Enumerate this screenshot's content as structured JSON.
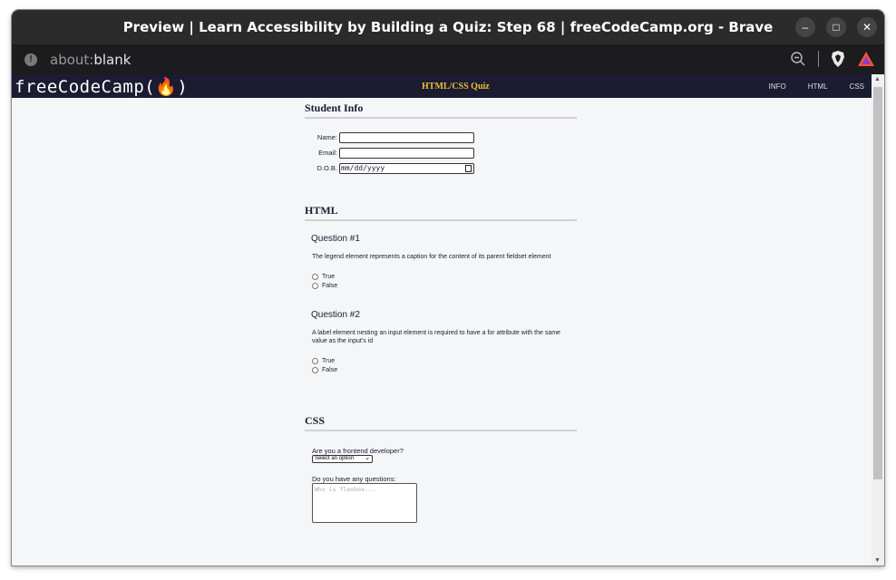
{
  "window": {
    "title": "Preview | Learn Accessibility by Building a Quiz: Step 68 | freeCodeCamp.org - Brave",
    "minimize_glyph": "–",
    "maximize_glyph": "□",
    "close_glyph": "✕"
  },
  "address_bar": {
    "scheme": "about:",
    "host": "blank"
  },
  "site": {
    "logo": "freeCodeCamp(🔥)",
    "quiz_title": "HTML/CSS Quiz",
    "nav": [
      "INFO",
      "HTML",
      "CSS"
    ]
  },
  "student_info": {
    "heading": "Student Info",
    "name_label": "Name:",
    "email_label": "Email:",
    "dob_label": "D.O.B.",
    "dob_placeholder": "mm/dd/yyyy"
  },
  "html_section": {
    "heading": "HTML",
    "questions": [
      {
        "title": "Question #1",
        "text": "The legend element represents a caption for the content of its parent fieldset element",
        "options": [
          "True",
          "False"
        ]
      },
      {
        "title": "Question #2",
        "text": "A label element nesting an input element is required to have a for attribute with the same value as the input's id",
        "options": [
          "True",
          "False"
        ]
      }
    ]
  },
  "css_section": {
    "heading": "CSS",
    "frontend_question": "Are you a frontend developer?",
    "select_value": "Select an option",
    "questions_label": "Do you have any questions:",
    "textarea_placeholder": "Who is flexbox..."
  },
  "colors": {
    "nav_bg": "#1b1b32",
    "quiz_title": "#f1be32",
    "page_bg": "#f5f6f7"
  }
}
